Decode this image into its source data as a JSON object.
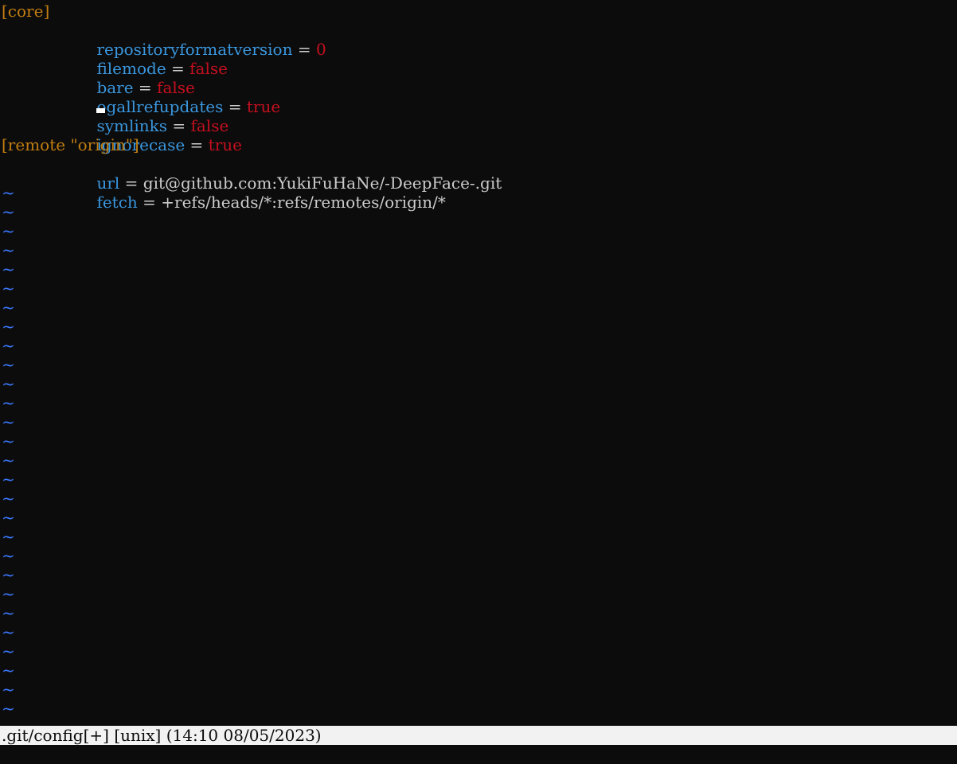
{
  "editor": {
    "core_header": "[core]",
    "lines": [
      {
        "key": "repositoryformatversion",
        "eq": " = ",
        "value": "0"
      },
      {
        "key": "filemode",
        "eq": " = ",
        "value": "false"
      },
      {
        "key": "bare",
        "eq": " = ",
        "value": "false"
      },
      {
        "key_first": "o",
        "key": "gallrefupdates",
        "eq": " = ",
        "value": "true"
      },
      {
        "key": "symlinks",
        "eq": " = ",
        "value": "false"
      },
      {
        "key": "ignorecase",
        "eq": " = ",
        "value": "true"
      }
    ],
    "remote_header_open": "[remote ",
    "remote_header_name": "\"origin\"",
    "remote_header_close": "]",
    "remote_lines": [
      {
        "key": "url",
        "eq": " = ",
        "value": "git@github.com:YukiFuHaNe/-DeepFace-.git"
      },
      {
        "key": "fetch",
        "eq": " = ",
        "value": "+refs/heads/*:refs/remotes/origin/*"
      }
    ],
    "empty_marker": "~"
  },
  "statusbar": {
    "text": ".git/config[+] [unix] (14:10 08/05/2023)"
  },
  "colors": {
    "background": "#0c0c0c",
    "section": "#c17d11",
    "key": "#3a96dd",
    "value": "#c50f1f",
    "tilde": "#3b78ff",
    "statusbar_bg": "#f2f2f2"
  }
}
